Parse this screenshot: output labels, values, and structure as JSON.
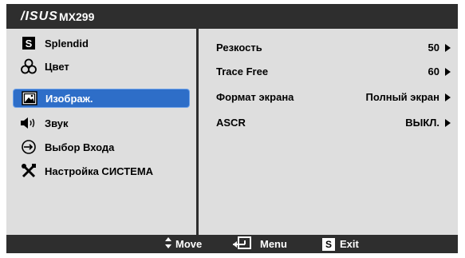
{
  "header": {
    "brand": "/ISUS",
    "model": "MX299"
  },
  "sidebar": {
    "items": [
      {
        "label": "Splendid",
        "icon": "splendid-s-icon"
      },
      {
        "label": "Цвет",
        "icon": "color-circles-icon"
      },
      {
        "label": "Изображ.",
        "icon": "image-icon",
        "selected": true
      },
      {
        "label": "Звук",
        "icon": "speaker-icon"
      },
      {
        "label": "Выбор Входа",
        "icon": "input-arrow-icon"
      },
      {
        "label": "Настройка СИСТЕМА",
        "icon": "tools-icon"
      }
    ]
  },
  "settings": [
    {
      "label": "Резкость",
      "value": "50"
    },
    {
      "label": "Trace Free",
      "value": "60"
    },
    {
      "label": "Формат экрана",
      "value": "Полный экран"
    },
    {
      "label": "ASCR",
      "value": "ВЫКЛ."
    }
  ],
  "footer": {
    "move": "Move",
    "menu": "Menu",
    "exit": "Exit",
    "exit_key": "S"
  },
  "colors": {
    "bar": "#2e2e2e",
    "panel": "#dedede",
    "accent": "#2e6ec8"
  }
}
